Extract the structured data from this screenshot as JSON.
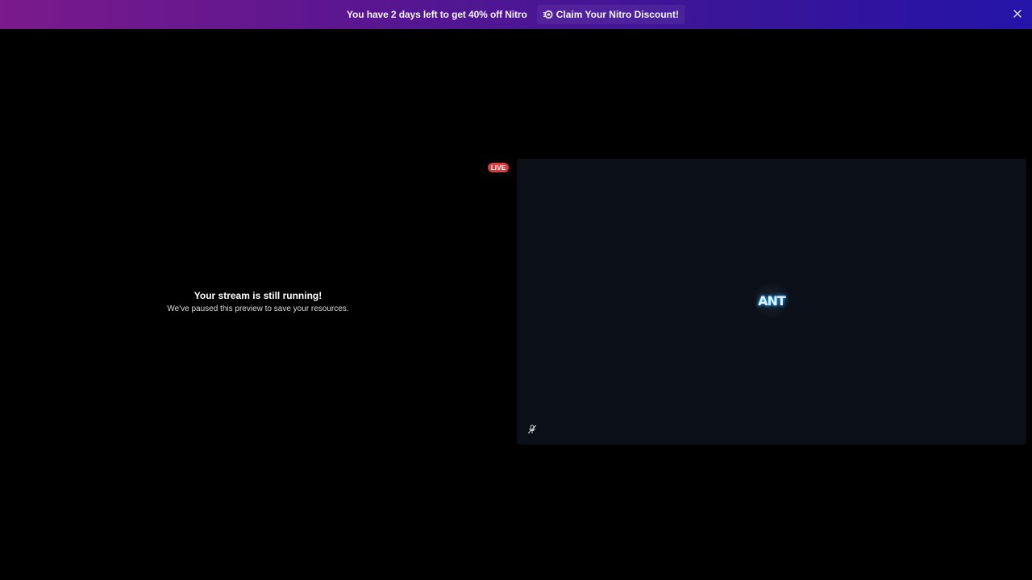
{
  "banner": {
    "message": "You have 2 days left to get 40% off Nitro",
    "claim_label": "Claim Your Nitro Discount!",
    "claim_icon": "nitro-icon",
    "close_icon": "close-icon"
  },
  "stream_preview": {
    "title": "Your stream is still running!",
    "subtitle": "We've paused this preview to save your resources.",
    "live_badge": "LIVE"
  },
  "participant_tile": {
    "avatar_text": "ANT",
    "mute_icon": "microphone-muted-icon"
  },
  "colors": {
    "background": "#000000",
    "tile_background": "#0b0f17",
    "live_red": "#d83c3e",
    "banner_start": "#7a1a8c",
    "banner_end": "#2414a8"
  }
}
